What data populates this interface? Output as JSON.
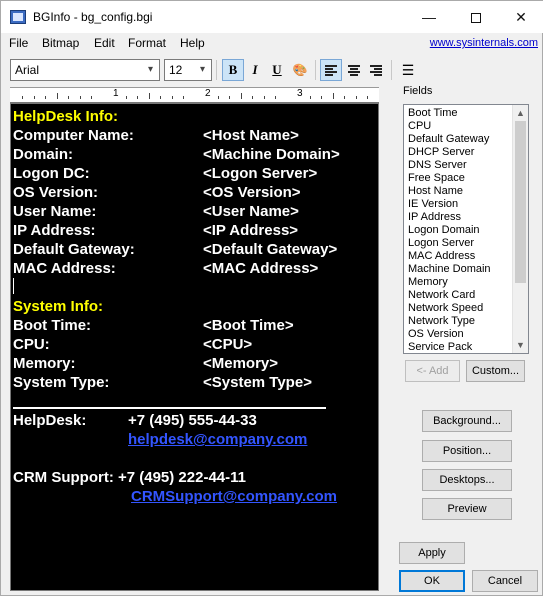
{
  "window": {
    "title": "BGInfo - bg_config.bgi",
    "minimize_glyph": "—",
    "close_glyph": "✕"
  },
  "menu": {
    "items": [
      "File",
      "Bitmap",
      "Edit",
      "Format",
      "Help"
    ],
    "link": "www.sysinternals.com"
  },
  "toolbar": {
    "font": "Arial",
    "size": "12",
    "bold": "B",
    "italic": "I",
    "underline": "U",
    "color_picker_glyph": "🎨",
    "bold_pressed": true,
    "align_left_pressed": true
  },
  "ruler": {
    "marks": [
      "1",
      "2",
      "3"
    ]
  },
  "editor": {
    "helpdesk_header": "HelpDesk Info:",
    "helpdesk_rows": [
      {
        "label": "Computer Name:",
        "value": "<Host Name>"
      },
      {
        "label": "Domain:",
        "value": "<Machine Domain>"
      },
      {
        "label": "Logon DC:",
        "value": "<Logon Server>"
      },
      {
        "label": "OS Version:",
        "value": "<OS Version>"
      },
      {
        "label": "User Name:",
        "value": "<User Name>"
      },
      {
        "label": "IP Address:",
        "value": "<IP Address>"
      },
      {
        "label": "Default Gateway:",
        "value": "<Default Gateway>"
      },
      {
        "label": "MAC Address:",
        "value": "<MAC Address>"
      }
    ],
    "system_header": "System Info:",
    "system_rows": [
      {
        "label": "Boot Time:",
        "value": "<Boot Time>"
      },
      {
        "label": "CPU:",
        "value": "<CPU>"
      },
      {
        "label": "Memory:",
        "value": "<Memory>"
      },
      {
        "label": "System Type:",
        "value": "<System Type>"
      }
    ],
    "contacts": {
      "helpdesk_label": "HelpDesk:",
      "helpdesk_phone": "+7 (495) 555-44-33",
      "helpdesk_email": "helpdesk@company.com",
      "crm_line": "CRM Support: +7 (495) 222-44-11",
      "crm_email": "CRMSupport@company.com"
    },
    "colors": {
      "background": "#000000",
      "header": "#ffff00",
      "text": "#ffffff",
      "link": "#3355ff"
    }
  },
  "fields": {
    "label": "Fields",
    "items": [
      "Boot Time",
      "CPU",
      "Default Gateway",
      "DHCP Server",
      "DNS Server",
      "Free Space",
      "Host Name",
      "IE Version",
      "IP Address",
      "Logon Domain",
      "Logon Server",
      "MAC Address",
      "Machine Domain",
      "Memory",
      "Network Card",
      "Network Speed",
      "Network Type",
      "OS Version",
      "Service Pack"
    ],
    "add_button": "<- Add",
    "custom_button": "Custom..."
  },
  "buttons": {
    "background": "Background...",
    "position": "Position...",
    "desktops": "Desktops...",
    "preview": "Preview",
    "apply": "Apply",
    "ok": "OK",
    "cancel": "Cancel"
  }
}
